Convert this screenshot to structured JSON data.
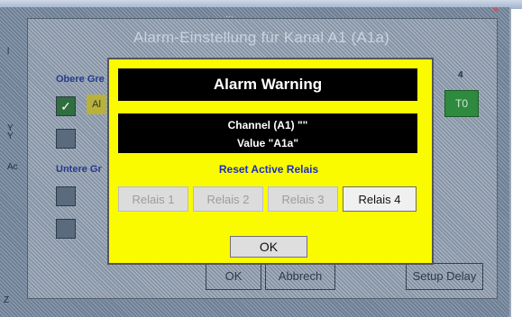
{
  "background_window": {
    "title": "Alarm-Einstellung für Kanal A1 (A1a)",
    "clock": "...",
    "close_glyph": "×",
    "upper_group_label": "Obere Gre",
    "lower_group_label": "Untere Gr",
    "upper_alarm_value": "Al",
    "side_glyphs": [
      "l",
      "Y\nY",
      "Ac",
      "Z"
    ],
    "right_number": "4",
    "right_button": "T0",
    "bottom_buttons": [
      "OK",
      "Abbrech",
      "Setup Delay"
    ]
  },
  "dialog": {
    "title": "Alarm Warning",
    "channel_line": "Channel (A1) \"\"",
    "value_line": "Value \"A1a\"",
    "reset_label": "Reset Active Relais",
    "relais": [
      {
        "label": "Relais 1",
        "active": false
      },
      {
        "label": "Relais 2",
        "active": false
      },
      {
        "label": "Relais 3",
        "active": false
      },
      {
        "label": "Relais 4",
        "active": true
      }
    ],
    "ok_label": "OK"
  },
  "colors": {
    "dialog_bg": "#fbfb00",
    "header_bg": "#000000",
    "reset_label": "#1c2ec0",
    "background_hatch": "#6d7f95"
  }
}
